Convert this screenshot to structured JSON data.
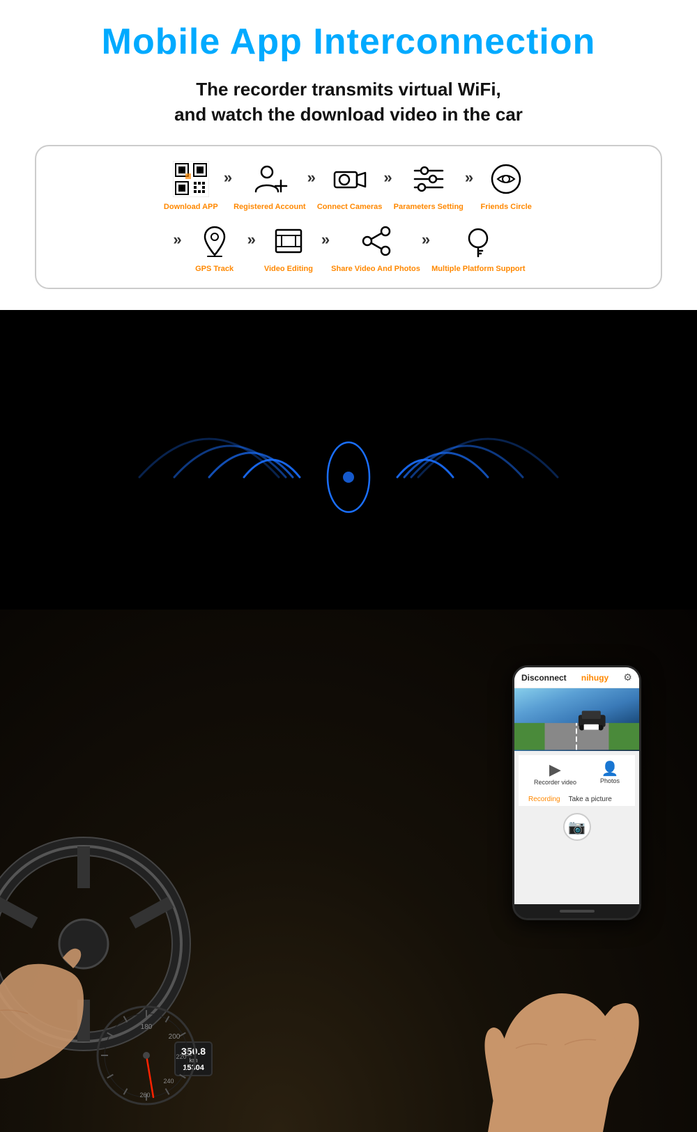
{
  "page": {
    "title": "Mobile App Interconnection",
    "subtitle_line1": "The recorder transmits virtual WiFi,",
    "subtitle_line2": "and watch the download video in the car"
  },
  "steps_row1": [
    {
      "id": "download-app",
      "label": "Download APP",
      "icon": "qr"
    },
    {
      "id": "registered-account",
      "label": "Registered Account",
      "icon": "user-add"
    },
    {
      "id": "connect-cameras",
      "label": "Connect Cameras",
      "icon": "camera"
    },
    {
      "id": "parameters-setting",
      "label": "Parameters Setting",
      "icon": "sliders"
    },
    {
      "id": "friends-circle",
      "label": "Friends Circle",
      "icon": "search-circle"
    }
  ],
  "steps_row2": [
    {
      "id": "gps-track",
      "label": "GPS Track",
      "icon": "gps"
    },
    {
      "id": "video-editing",
      "label": "Video Editing",
      "icon": "video-edit"
    },
    {
      "id": "share-video",
      "label": "Share Video And Photos",
      "icon": "share"
    },
    {
      "id": "multi-platform",
      "label": "Multiple Platform Support",
      "icon": "key"
    }
  ],
  "phone": {
    "disconnect_label": "Disconnect",
    "user_name": "nihugy",
    "recorder_video_label": "Recorder video",
    "photos_label": "Photos",
    "recording_label": "Recording",
    "take_picture_label": "Take a picture"
  },
  "speedometer": {
    "speed": "350.8",
    "unit": "km",
    "odometer": "15304"
  },
  "colors": {
    "title": "#00aaff",
    "label_orange": "#ff8800",
    "background": "#000000",
    "top_bg": "#ffffff"
  }
}
